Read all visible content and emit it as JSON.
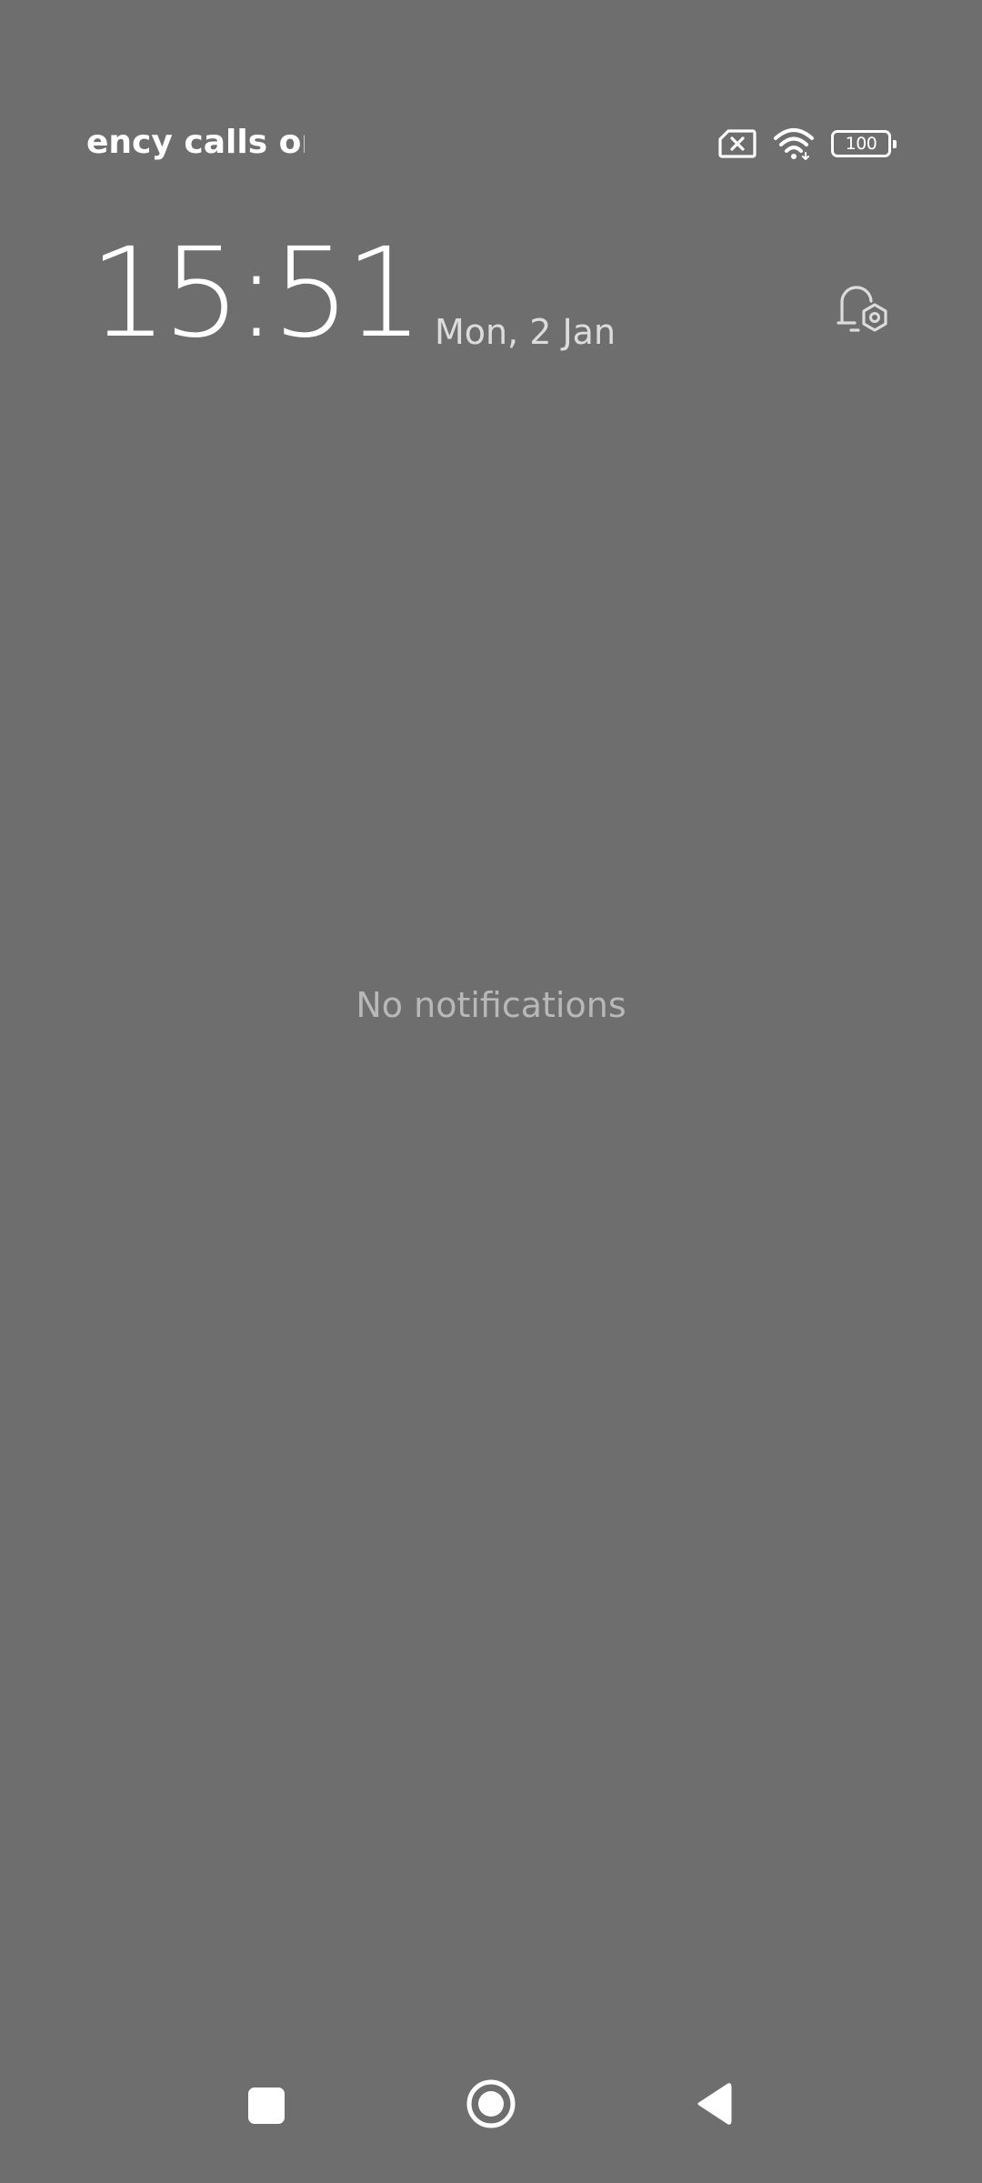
{
  "status_bar": {
    "carrier_text": "ency calls only",
    "battery_level": "100",
    "icons": [
      "no-sim-icon",
      "wifi-icon",
      "battery-icon"
    ]
  },
  "header": {
    "time": "15:51",
    "date": "Mon, 2 Jan",
    "settings_icon": "notification-settings-icon"
  },
  "notifications": {
    "empty_message": "No notifications"
  },
  "nav_bar": {
    "icons": [
      "recents-icon",
      "home-icon",
      "back-icon"
    ]
  },
  "colors": {
    "background": "#6e6e6e",
    "primary_text": "#ffffff",
    "secondary_text": "#dcdcdc",
    "muted_text": "#b8b8b8"
  }
}
